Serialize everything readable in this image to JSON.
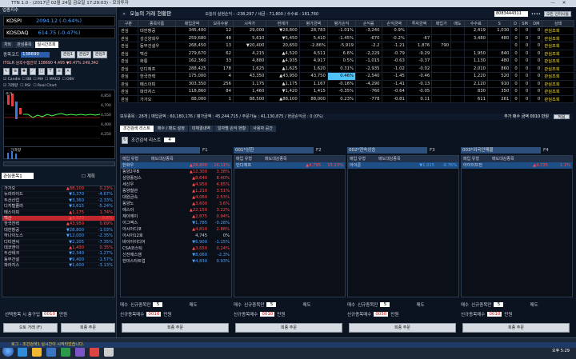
{
  "window": {
    "title": "TTN 1.0 - (2017년 02월 24일 금요일 17:29:03) - 모의투자"
  },
  "left": {
    "header": "업종지수",
    "indices": [
      {
        "name": "KOSPI",
        "value": "2094.12 (-0.64%)"
      },
      {
        "name": "KOSDAQ",
        "value": "614.75 (-0.47%)"
      }
    ],
    "tabs": [
      "차트",
      "관심종목",
      "실시간조회"
    ],
    "stock_code": "138690",
    "buttons": [
      "관심1",
      "관심2",
      "관심3"
    ],
    "stock_line": "ITGLR 원후수캠전약 138690 4,495 ▼0.47% 249,342",
    "chart_label": "가격량",
    "list_title": "관심종목1",
    "list_check": "계획",
    "list": [
      {
        "n": "가가오",
        "p": "▲88,100",
        "r": "0.23%",
        "c": "up"
      },
      {
        "n": "뉴라라이드",
        "p": "▼3,370",
        "r": "-4.67%",
        "c": "down"
      },
      {
        "n": "두산산업",
        "p": "▼3,360",
        "r": "-2.33%",
        "c": "down"
      },
      {
        "n": "디지털플러",
        "p": "▼3,615",
        "r": "-5.24%",
        "c": "down"
      },
      {
        "n": "메스이피",
        "p": "▲1,175",
        "r": "1.74%",
        "c": "up"
      },
      {
        "n": "백산",
        "p": "▲4,520",
        "r": "0.6%",
        "c": "up",
        "sel": true
      },
      {
        "n": "한국전력",
        "p": "▲43,950",
        "r": "0.69%",
        "c": "up"
      },
      {
        "n": "대한항공",
        "p": "▼28,800",
        "r": "-1.03%",
        "c": "down"
      },
      {
        "n": "하나이노스",
        "p": "▼12,000",
        "r": "-2.35%",
        "c": "down"
      },
      {
        "n": "디티앤씨",
        "p": "▼2,205",
        "r": "-7.35%",
        "c": "down"
      },
      {
        "n": "데코앤이",
        "p": "▲1,430",
        "r": "0.35%",
        "c": "up"
      },
      {
        "n": "두산테크",
        "p": "▼2,340",
        "r": "-1.27%",
        "c": "down"
      },
      {
        "n": "동부건설",
        "p": "▼9,400",
        "r": "-1.57%",
        "c": "down"
      },
      {
        "n": "파라지스",
        "p": "▼1,600",
        "r": "-3.13%",
        "c": "down"
      }
    ],
    "order_label": "선택종목 시 총구입",
    "order_value": "0010",
    "order_unit": "만원",
    "bottom_buttons": [
      "오토 거래 (F)",
      "회종 주문"
    ]
  },
  "main": {
    "title": "오늘의 거래 현황판",
    "summary": "오늘의 실현손익 : -238,297 / 세금 : 71,800 / 수수료 : 181,760",
    "account": "8083444311",
    "pw": "••••",
    "login": "모든 인터시동",
    "columns": [
      "구분",
      "종목이름",
      "매입금액",
      "보유수량",
      "시작가",
      "현재가",
      "평가금액",
      "평가손익",
      "손익률",
      "손익금액",
      "투자금액",
      "매입가",
      "매도",
      "수수료",
      "S",
      "D",
      "SM",
      "DM",
      "상태"
    ],
    "rows": [
      [
        "관심",
        "대한항공",
        "345,400",
        "12",
        "29,000",
        "▼28,800",
        "28,783",
        "-1.01%",
        "-3,240",
        "0.9%",
        "",
        "",
        "",
        "2,419",
        "1,030",
        "0",
        "0",
        "0",
        "관심조회"
      ],
      [
        "관심",
        "성신양회우",
        "259,680",
        "48",
        "5,610",
        "▼5,450",
        "5,410",
        "-1.45%",
        "-670",
        "-0.2%",
        "-67",
        "",
        "",
        "3,480",
        "480",
        "0",
        "0",
        "0",
        "관심조회"
      ],
      [
        "관심",
        "동부건설우",
        "268,450",
        "13",
        "▼20,400",
        "20,650",
        "-2.86%",
        "-5,919",
        "-2.2",
        "-1.21",
        "1,876",
        "790",
        "",
        "",
        "",
        "0",
        "0",
        "0",
        "관심조회"
      ],
      [
        "관심",
        "백산",
        "279,670",
        "62",
        "4,215",
        "▲4,520",
        "4,511",
        "6.6%",
        "-2,229",
        "-0.79",
        "-9.29",
        "",
        "",
        "1,950",
        "840",
        "0",
        "0",
        "0",
        "관심조회"
      ],
      [
        "관심",
        "화통",
        "162,360",
        "33",
        "4,880",
        "▲4,935",
        "4,917",
        "0.5%",
        "-1,015",
        "-0.63",
        "-0.37",
        "",
        "",
        "1,130",
        "480",
        "0",
        "0",
        "0",
        "관심조회"
      ],
      [
        "관심",
        "인디에프",
        "288,425",
        "178",
        "1,625",
        "▲1,625",
        "1,620",
        "0.31%",
        "-2,935",
        "-1.02",
        "-0.02",
        "",
        "",
        "2,010",
        "860",
        "0",
        "0",
        "0",
        "관심조회"
      ],
      [
        "관심",
        "한국전력",
        "175,000",
        "4",
        "43,350",
        "▲43,950",
        "43,750",
        "0.46%",
        "-2,540",
        "-1.45",
        "-0.46",
        "",
        "",
        "1,220",
        "520",
        "0",
        "0",
        "0",
        "관심조회"
      ],
      [
        "관심",
        "메스이피",
        "303,350",
        "256",
        "1,175",
        "▲1,175",
        "1,167",
        "-0.16%",
        "-4,290",
        "-1.41",
        "-0.13",
        "",
        "",
        "2,120",
        "910",
        "0",
        "0",
        "0",
        "관심조회"
      ],
      [
        "관심",
        "파라지스",
        "118,860",
        "84",
        "1,460",
        "▼1,420",
        "1,415",
        "-0.35%",
        "-760",
        "-0.64",
        "-0.05",
        "",
        "",
        "830",
        "350",
        "0",
        "0",
        "0",
        "관심조회"
      ],
      [
        "관심",
        "가가오",
        "88,000",
        "1",
        "88,500",
        "▲88,100",
        "88,000",
        "0.23%",
        "-778",
        "-0.81",
        "0.11",
        "",
        "",
        "611",
        "261",
        "0",
        "0",
        "0",
        "관심조회"
      ]
    ],
    "footer": "보유종목 : 28개  |  매입금액 : 60,180,176 / 평가금액 : 45,244,715 / 주문가능 : 41,130,875 / 현금손익금 : 0 (0%)",
    "footer_right": "추가 매수 금액 0010 만원",
    "subtabs": [
      "조건검색 리스트",
      "매수 / 매도 설정",
      "미체결내역",
      "일자별 손익 현황",
      "사용자 공간"
    ],
    "condition_num": "4",
    "panels": [
      {
        "key": "F1",
        "name": "",
        "stocks": [
          {
            "n": "한화우",
            "p": "▲29,800",
            "r": "16.11%",
            "c": "up",
            "sel": true
          },
          {
            "n": "동양2우B",
            "p": "▲12,300",
            "r": "3.38%",
            "c": "up"
          },
          {
            "n": "삼양홀딩스",
            "p": "▲8,640",
            "r": "8.40%",
            "c": "up"
          },
          {
            "n": "세신우",
            "p": "▲4,950",
            "r": "4.65%",
            "c": "up"
          },
          {
            "n": "동양철관",
            "p": "▲1,210",
            "r": "3.51%",
            "c": "up"
          },
          {
            "n": "대원금속",
            "p": "▲4,060",
            "r": "2.53%",
            "c": "up"
          },
          {
            "n": "동양노",
            "p": "▲3,600",
            "r": "3.6%",
            "c": "up"
          },
          {
            "n": "에스이",
            "p": "▲22,150",
            "r": "3.22%",
            "c": "up"
          },
          {
            "n": "제이에이",
            "p": "▲2,875",
            "r": "0.94%",
            "c": "up"
          },
          {
            "n": "이그엑스",
            "p": "▼1,785",
            "r": "-0.28%",
            "c": "down"
          },
          {
            "n": "아시아디코",
            "p": "▲4,810",
            "r": "2.88%",
            "c": "up"
          },
          {
            "n": "아시아12호",
            "p": "4,745",
            "r": "0%",
            "c": ""
          },
          {
            "n": "바이아이디어",
            "p": "▼6,900",
            "r": "-1.15%",
            "c": "down"
          },
          {
            "n": "CSA코스틱",
            "p": "▲3,650",
            "r": "0.24%",
            "c": "up"
          },
          {
            "n": "신진에스엠",
            "p": "▼8,060",
            "r": "-2.3%",
            "c": "down"
          },
          {
            "n": "한미스타트업",
            "p": "▼4,830",
            "r": "0.93%",
            "c": "down"
          }
        ]
      },
      {
        "key": "F2",
        "name": "001*상한",
        "stocks": [
          {
            "n": "인디에프",
            "p": "▲4,795",
            "r": "15.23%",
            "c": "up",
            "sel": true
          }
        ]
      },
      {
        "key": "F3",
        "name": "002*연속상승",
        "stocks": [
          {
            "n": "아이준",
            "p": "▼1,015",
            "r": "-9.76%",
            "c": "down",
            "sel": true
          }
        ]
      },
      {
        "key": "F4",
        "name": "003*외국인매물",
        "stocks": [
          {
            "n": "아이이뜨전",
            "p": "▲4,735",
            "r": "1.1%",
            "c": "up",
            "sel": true
          }
        ]
      }
    ],
    "mode_label": "매입 유형",
    "filter_label": "매도대상종목",
    "opt_buy": "매수",
    "opt_sell": "매도",
    "cond_check": "신규종목만",
    "qty": "5",
    "amount_label": "신규종목매수",
    "unit": "만원",
    "panel_amounts": [
      "0010",
      "0010",
      "0050",
      "0010"
    ],
    "order_button": "회종 주문"
  },
  "status": {
    "text": "로그 - 조건검색1 실시간이 시작되었습니다."
  },
  "taskbar": {
    "clock": "오후 5:29"
  }
}
